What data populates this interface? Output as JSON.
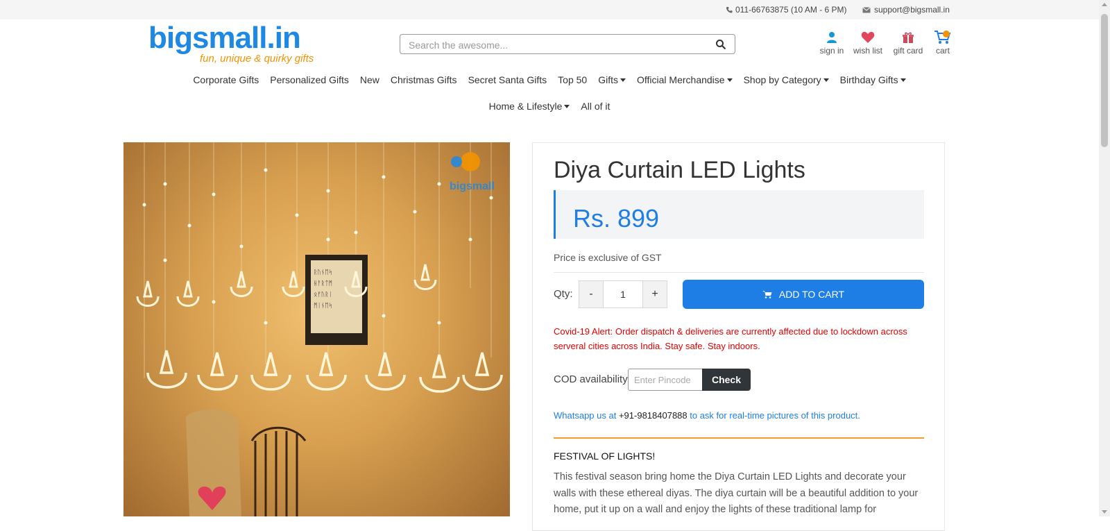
{
  "topbar": {
    "phone": "011-66763875 (10 AM - 6 PM)",
    "email": "support@bigsmall.in"
  },
  "logo": {
    "name": "bigsmall.in",
    "tagline": "fun, unique & quirky gifts"
  },
  "search": {
    "placeholder": "Search the awesome..."
  },
  "header_links": {
    "signin": "sign in",
    "wishlist": "wish list",
    "giftcard": "gift card",
    "cart": "cart"
  },
  "nav": {
    "row1": [
      {
        "label": "Corporate Gifts",
        "dropdown": false
      },
      {
        "label": "Personalized Gifts",
        "dropdown": false
      },
      {
        "label": "New",
        "dropdown": false
      },
      {
        "label": "Christmas Gifts",
        "dropdown": false
      },
      {
        "label": "Secret Santa Gifts",
        "dropdown": false
      },
      {
        "label": "Top 50",
        "dropdown": false
      },
      {
        "label": "Gifts",
        "dropdown": true
      },
      {
        "label": "Official Merchandise",
        "dropdown": true
      },
      {
        "label": "Shop by Category",
        "dropdown": true
      },
      {
        "label": "Birthday Gifts",
        "dropdown": true
      }
    ],
    "row2": [
      {
        "label": "Home & Lifestyle",
        "dropdown": true
      },
      {
        "label": "All of it",
        "dropdown": false
      }
    ]
  },
  "product": {
    "title": "Diya Curtain LED Lights",
    "price": "Rs. 899",
    "gst_note": "Price is exclusive of GST",
    "qty_label": "Qty:",
    "qty_minus": "-",
    "qty_value": "1",
    "qty_plus": "+",
    "add_to_cart": "ADD TO CART",
    "alert": "Covid-19 Alert: Order dispatch & deliveries are currently affected due to lockdown across serveral cities across India. Stay safe. Stay indoors.",
    "cod_label": "COD availability",
    "pincode_placeholder": "Enter Pincode",
    "check_button": "Check",
    "whatsapp_prefix": "Whatsapp us at ",
    "whatsapp_number": "+91-9818407888",
    "whatsapp_suffix": " to ask for real-time pictures of this product.",
    "section_heading": "FESTIVAL OF LIGHTS!",
    "description": "This festival season bring home the Diya Curtain LED Lights and decorate your walls with these ethereal diyas. The diya curtain will be a beautiful addition to your home, put it up on a wall and enjoy the lights of these traditional lamp for"
  },
  "colors": {
    "brand_blue": "#1e7ee6",
    "brand_orange": "#f39200",
    "alert_red": "#e00000",
    "check_dark": "#2f3538"
  }
}
